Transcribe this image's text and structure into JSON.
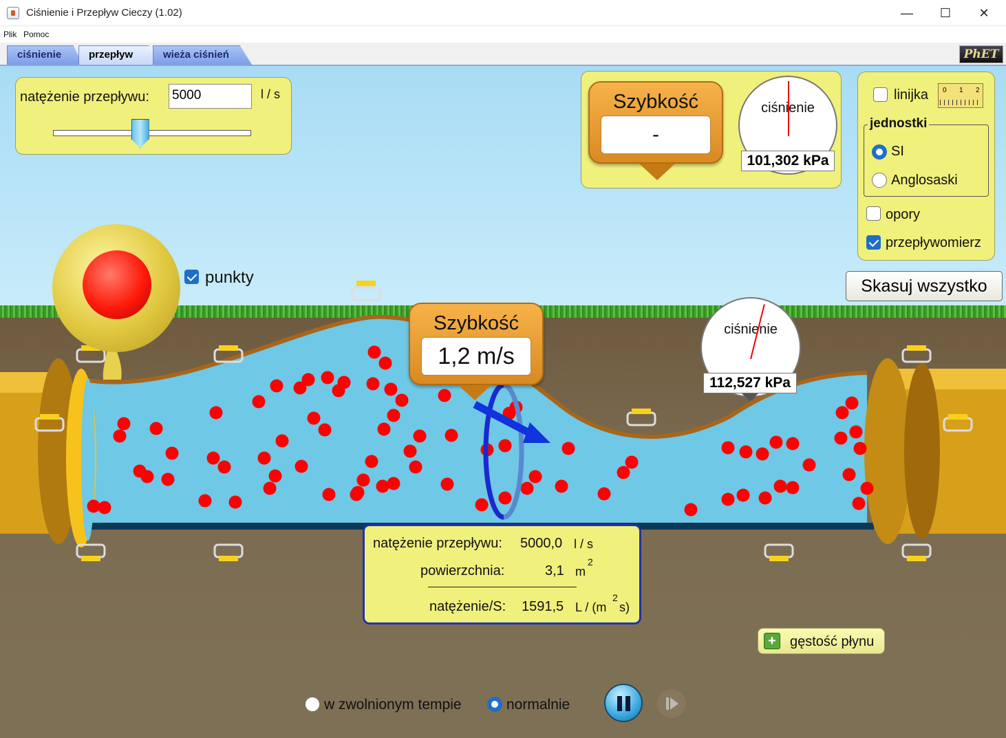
{
  "window": {
    "title": "Ciśnienie i Przepływ Cieczy (1.02)",
    "minimize": "—",
    "maximize": "☐",
    "close": "✕"
  },
  "menu": [
    "Plik",
    "Pomoc"
  ],
  "tabs": [
    {
      "label": "ciśnienie",
      "active": false
    },
    {
      "label": "przepływ",
      "active": true
    },
    {
      "label": "wieża ciśnień",
      "active": false
    }
  ],
  "logo_text": "PhET",
  "flow_rate_panel": {
    "label": "natężenie przepływu:",
    "value": "5000",
    "unit": "l / s",
    "slider_fraction": 0.44
  },
  "speed_meter_top": {
    "title": "Szybkość",
    "value": "-"
  },
  "gauge_top": {
    "label": "ciśnienie",
    "reading": "101,302 kPa"
  },
  "side_panel": {
    "ruler_label": "linijka",
    "ruler_checked": false,
    "ruler_ticks": [
      "0",
      "1",
      "2"
    ],
    "units_title": "jednostki",
    "units": [
      {
        "label": "SI",
        "selected": true
      },
      {
        "label": "Anglosaski",
        "selected": false
      }
    ],
    "friction_label": "opory",
    "friction_checked": false,
    "flowmeter_label": "przepływomierz",
    "flowmeter_checked": true
  },
  "reset_button": "Skasuj wszystko",
  "dots_checkbox": {
    "label": "punkty",
    "checked": true
  },
  "speed_meter_pipe": {
    "title": "Szybkość",
    "value": "1,2 m/s"
  },
  "gauge_pipe": {
    "label": "ciśnienie",
    "reading": "112,527 kPa"
  },
  "flowmeter_readout": {
    "rate_label": "natężenie przepływu:",
    "rate_value": "5000,0",
    "rate_unit": "l / s",
    "area_label": "powierzchnia:",
    "area_value": "3,1",
    "area_unit": "m",
    "area_exp": "2",
    "flux_label": "natężenie/S:",
    "flux_value": "1591,5",
    "flux_unit_a": "L / (m",
    "flux_exp": "2",
    "flux_unit_b": "s)"
  },
  "fluid_density_button": "gęstość płynu",
  "playback": {
    "slow_label": "w zwolnionym tempie",
    "slow_selected": false,
    "normal_label": "normalnie",
    "normal_selected": true,
    "pause_icon": "pause-icon",
    "step_icon": "step-icon"
  },
  "colors": {
    "water": "#6ec8e6",
    "particle": "#ff0000",
    "pipe_edge": "#a8661c",
    "panel": "#f0f07c",
    "flowmeter_ring": "#1a2acc"
  }
}
